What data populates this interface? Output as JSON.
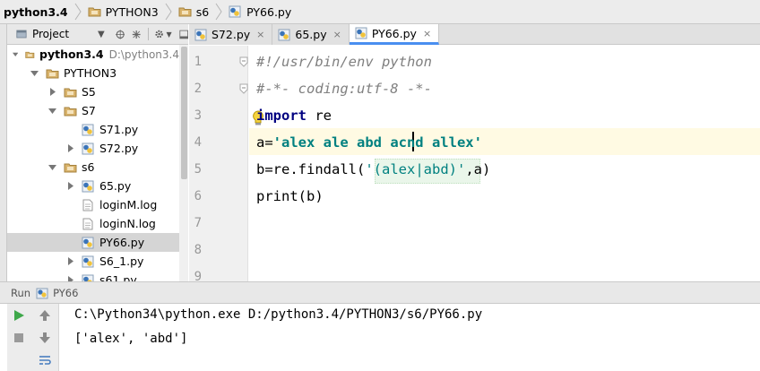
{
  "breadcrumb": [
    {
      "label": "python3.4",
      "bold": true
    },
    {
      "label": "PYTHON3",
      "bold": false
    },
    {
      "label": "s6",
      "bold": false
    },
    {
      "label": "PY66.py",
      "bold": false
    }
  ],
  "project_panel": {
    "title": "Project",
    "tree": [
      {
        "label": "python3.4",
        "sub": "D:\\python3.4",
        "kind": "folder",
        "depth": 0,
        "state": "open",
        "bold": true
      },
      {
        "label": "PYTHON3",
        "kind": "folder",
        "depth": 1,
        "state": "open"
      },
      {
        "label": "S5",
        "kind": "folder",
        "depth": 2,
        "state": "closed"
      },
      {
        "label": "S7",
        "kind": "folder",
        "depth": 2,
        "state": "open"
      },
      {
        "label": "S71.py",
        "kind": "py",
        "depth": 3,
        "state": "none"
      },
      {
        "label": "S72.py",
        "kind": "py",
        "depth": 3,
        "state": "closed"
      },
      {
        "label": "s6",
        "kind": "folder",
        "depth": 2,
        "state": "open"
      },
      {
        "label": "65.py",
        "kind": "py",
        "depth": 3,
        "state": "closed"
      },
      {
        "label": "loginM.log",
        "kind": "log",
        "depth": 3,
        "state": "none"
      },
      {
        "label": "loginN.log",
        "kind": "log",
        "depth": 3,
        "state": "none"
      },
      {
        "label": "PY66.py",
        "kind": "py",
        "depth": 3,
        "state": "none",
        "selected": true
      },
      {
        "label": "S6_1.py",
        "kind": "py",
        "depth": 3,
        "state": "closed"
      },
      {
        "label": "s61.py",
        "kind": "py",
        "depth": 3,
        "state": "closed"
      }
    ]
  },
  "tabs": [
    {
      "label": "S72.py",
      "active": false
    },
    {
      "label": "65.py",
      "active": false
    },
    {
      "label": "PY66.py",
      "active": true
    }
  ],
  "editor": {
    "line_numbers": [
      "1",
      "2",
      "3",
      "4",
      "5",
      "6",
      "7",
      "8",
      "9"
    ],
    "lines": [
      [
        {
          "t": "#!/usr/bin/env python",
          "c": "cm"
        }
      ],
      [
        {
          "t": "#-*- coding:utf-8 -*-",
          "c": "cm"
        }
      ],
      [
        {
          "t": "import",
          "c": "kw"
        },
        {
          "t": " re",
          "c": ""
        }
      ],
      [
        {
          "t": "a=",
          "c": ""
        },
        {
          "t": "'alex ale abd acnd allex'",
          "c": "st"
        }
      ],
      [
        {
          "t": "b=re.findall(",
          "c": ""
        },
        {
          "t": "'(alex|abd)'",
          "c": "stn"
        },
        {
          "t": ",a)",
          "c": ""
        }
      ],
      [
        {
          "t": "print",
          "c": ""
        },
        {
          "t": "(b)",
          "c": ""
        }
      ]
    ]
  },
  "run_panel": {
    "label": "Run",
    "config": "PY66",
    "output": [
      "C:\\Python34\\python.exe D:/python3.4/PYTHON3/s6/PY66.py",
      "['alex', 'abd']"
    ]
  },
  "colors": {
    "accent": "#4a8ff0",
    "selection": "#d5d5d5",
    "current_line": "#fffae3",
    "run_green": "#3ea84a"
  }
}
